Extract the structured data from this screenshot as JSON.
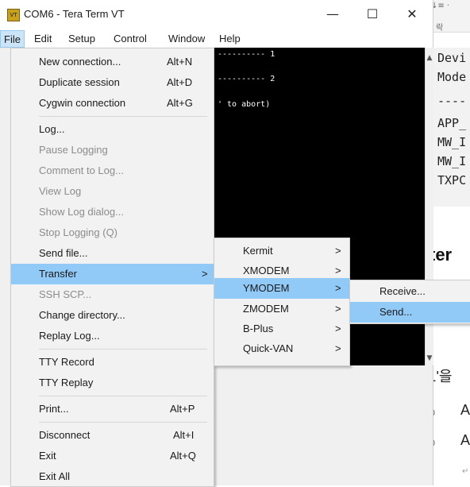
{
  "window": {
    "title": "COM6 - Tera Term VT",
    "icon_text": "VT",
    "minimize": "—",
    "maximize": "☐",
    "close": "✕"
  },
  "menubar": {
    "items": [
      "File",
      "Edit",
      "Setup",
      "Control",
      "Window",
      "Help"
    ]
  },
  "terminal": {
    "lines": [
      "---------- 1",
      "---------- 2",
      "' to abort)"
    ]
  },
  "file_menu": {
    "items": [
      {
        "label": "New connection...",
        "shortcut": "Alt+N",
        "enabled": true
      },
      {
        "label": "Duplicate session",
        "shortcut": "Alt+D",
        "enabled": true
      },
      {
        "label": "Cygwin connection",
        "shortcut": "Alt+G",
        "enabled": true
      },
      {
        "label": "Log...",
        "shortcut": "",
        "enabled": true
      },
      {
        "label": "Pause Logging",
        "shortcut": "",
        "enabled": false
      },
      {
        "label": "Comment to Log...",
        "shortcut": "",
        "enabled": false
      },
      {
        "label": "View Log",
        "shortcut": "",
        "enabled": false
      },
      {
        "label": "Show Log dialog...",
        "shortcut": "",
        "enabled": false
      },
      {
        "label": "Stop Logging (Q)",
        "shortcut": "",
        "enabled": false
      },
      {
        "label": "Send file...",
        "shortcut": "",
        "enabled": true
      },
      {
        "label": "Transfer",
        "shortcut": "",
        "enabled": true,
        "submenu": true,
        "highlighted": true
      },
      {
        "label": "SSH SCP...",
        "shortcut": "",
        "enabled": false
      },
      {
        "label": "Change directory...",
        "shortcut": "",
        "enabled": true
      },
      {
        "label": "Replay Log...",
        "shortcut": "",
        "enabled": true
      },
      {
        "label": "TTY Record",
        "shortcut": "",
        "enabled": true
      },
      {
        "label": "TTY Replay",
        "shortcut": "",
        "enabled": true
      },
      {
        "label": "Print...",
        "shortcut": "Alt+P",
        "enabled": true
      },
      {
        "label": "Disconnect",
        "shortcut": "Alt+I",
        "enabled": true
      },
      {
        "label": "Exit",
        "shortcut": "Alt+Q",
        "enabled": true
      },
      {
        "label": "Exit All",
        "shortcut": "",
        "enabled": true
      }
    ]
  },
  "transfer_menu": {
    "items": [
      {
        "label": "Kermit",
        "highlighted": false
      },
      {
        "label": "XMODEM",
        "highlighted": false
      },
      {
        "label": "YMODEM",
        "highlighted": true
      },
      {
        "label": "ZMODEM",
        "highlighted": false
      },
      {
        "label": "B-Plus",
        "highlighted": false
      },
      {
        "label": "Quick-VAN",
        "highlighted": false
      }
    ],
    "arrow": ">"
  },
  "ymodem_menu": {
    "items": [
      {
        "label": "Receive...",
        "highlighted": false
      },
      {
        "label": "Send...",
        "highlighted": true
      }
    ]
  },
  "background_doc": {
    "top_glyph": "↓≡ ·",
    "tab": "락",
    "code_lines": [
      "Devi",
      "Mode",
      "----",
      "APP_",
      "MW_I",
      "MW_I",
      "TXPC"
    ],
    "heading": "ter",
    "sub": "| 뷰",
    "dash": "-",
    "item_1": "'1'을",
    "bullet_a": "A",
    "bullet_b": "A",
    "bullet_symbol": "○",
    "return_mark": "↵"
  },
  "colors": {
    "menu_highlight": "#91c9f7",
    "terminal_bg": "#000000",
    "terminal_fg": "#ffffff"
  }
}
